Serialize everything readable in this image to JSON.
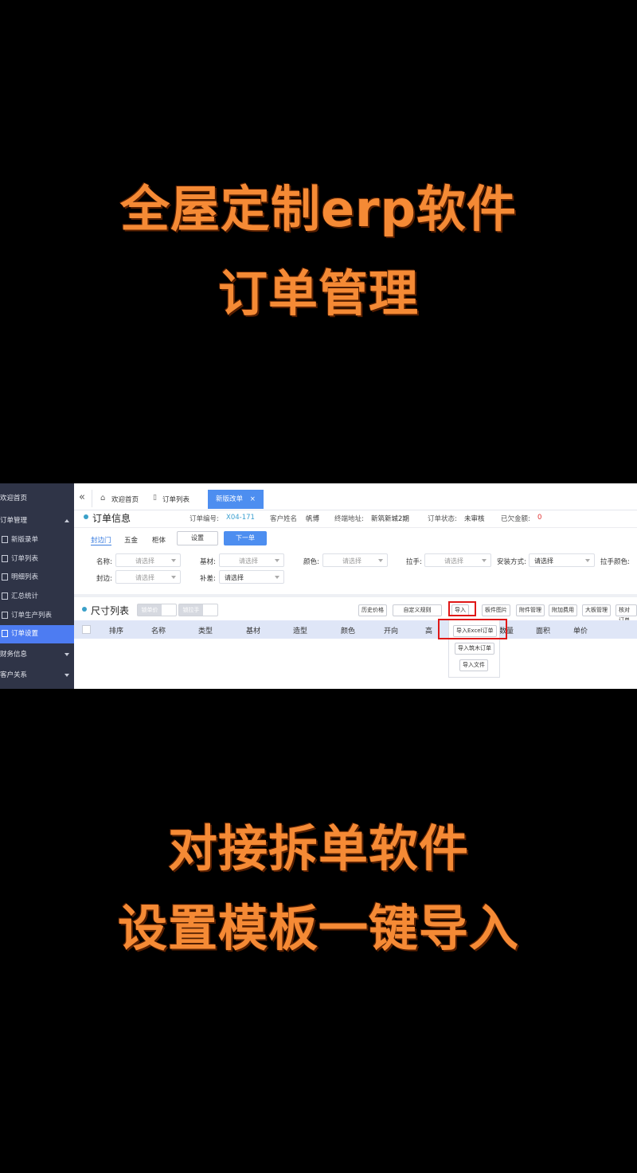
{
  "captions": [
    "全屋定制erp软件",
    "订单管理",
    "对接拆单软件",
    "设置模板一键导入"
  ],
  "sidebar": {
    "items": [
      {
        "label": "欢迎首页"
      },
      {
        "label": "订单管理"
      },
      {
        "label": "新版录单"
      },
      {
        "label": "订单列表"
      },
      {
        "label": "明细列表"
      },
      {
        "label": "汇总统计"
      },
      {
        "label": "订单生产列表"
      },
      {
        "label": "订单设置"
      },
      {
        "label": "财务信息"
      },
      {
        "label": "客户关系"
      }
    ]
  },
  "tabs": {
    "collapse_icon": "«",
    "home": "欢迎首页",
    "list": "订单列表",
    "active": "新版改单",
    "close": "×"
  },
  "order_info": {
    "title": "订单信息",
    "order_no_label": "订单编号:",
    "order_no": "X04-171",
    "customer_label": "客户姓名",
    "customer": "帆博",
    "address_label": "终端地址:",
    "address": "新筑新城2期",
    "status_label": "订单状态:",
    "status": "未审核",
    "owed_label": "已欠金额:",
    "owed": "0"
  },
  "subtabs": [
    "封边门",
    "五金",
    "柜体"
  ],
  "buttons": {
    "settings": "设置",
    "next": "下一单"
  },
  "filters": {
    "name_label": "名称:",
    "material_label": "基材:",
    "color_label": "颜色:",
    "handle_label": "拉手:",
    "install_label": "安装方式:",
    "handle_color_label": "拉手颜色:",
    "edge_label": "封边:",
    "patch_label": "补差:",
    "placeholder": "请选择"
  },
  "size_list": {
    "title": "尺寸列表",
    "switch1": "锁单价",
    "switch2": "锁拉手",
    "buttons": [
      "历史价格",
      "自定义规则",
      "导入",
      "板件图片",
      "附件管理",
      "附加费用",
      "大板管理",
      "核对订单"
    ],
    "dropdown": [
      "导入Excel订单",
      "导入筑木订单",
      "导入文件"
    ]
  },
  "table": {
    "columns": [
      "排序",
      "名称",
      "类型",
      "基材",
      "造型",
      "颜色",
      "开向",
      "高",
      "数量",
      "面积",
      "单价"
    ]
  }
}
